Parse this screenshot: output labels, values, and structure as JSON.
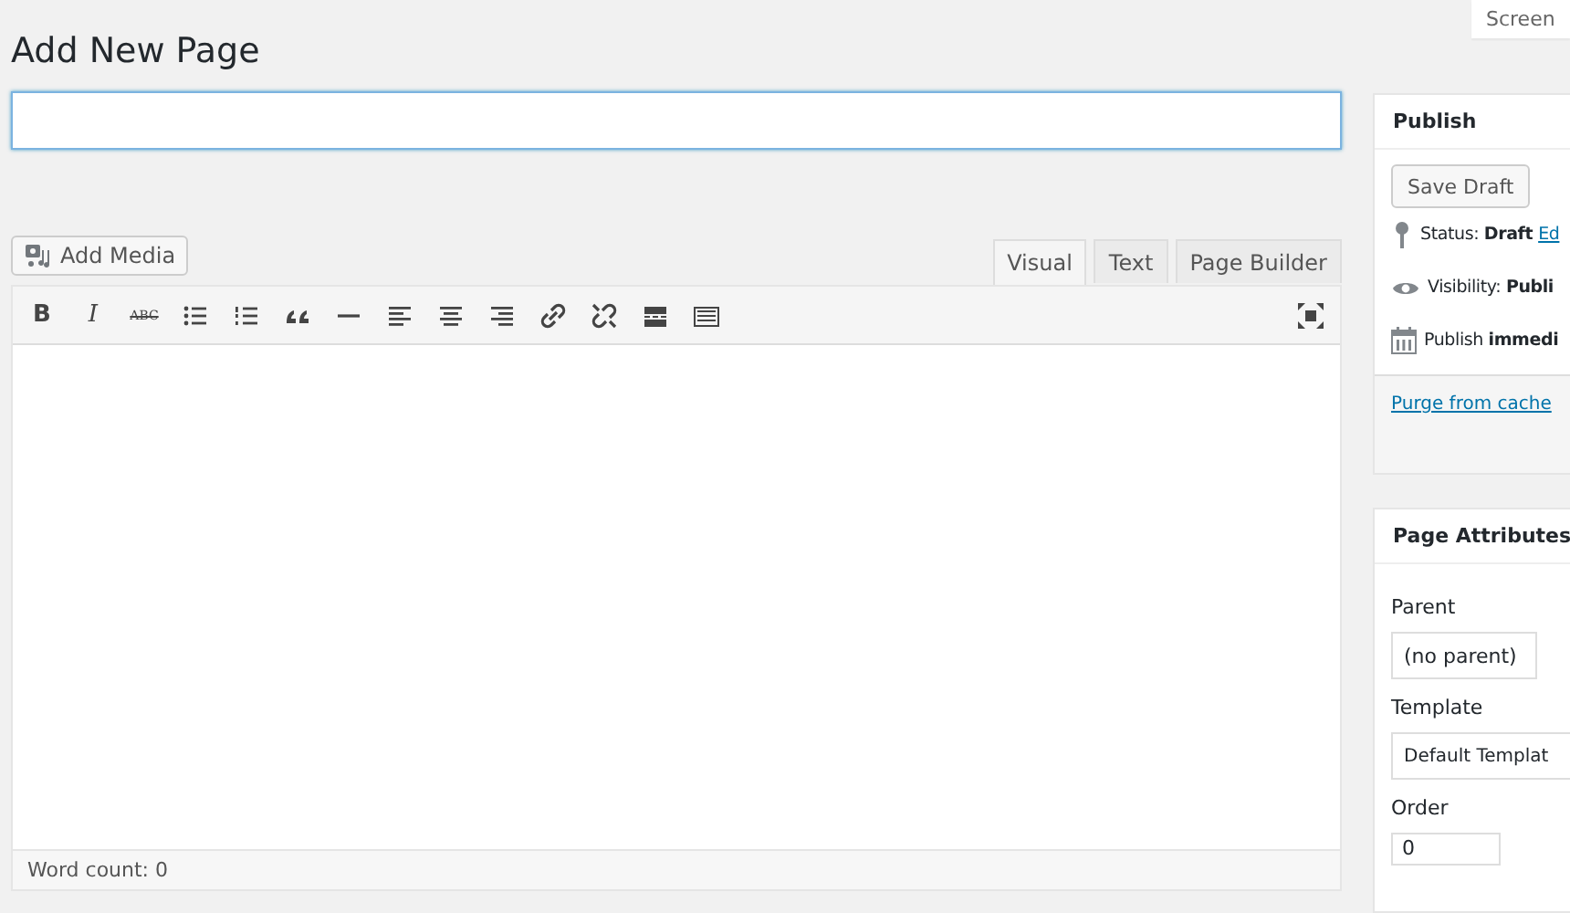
{
  "screen_options": "Screen",
  "heading": "Add New Page",
  "title_field": {
    "focused": true
  },
  "add_media": "Add Media",
  "editor_tabs": [
    {
      "label": "Visual",
      "selected": true
    },
    {
      "label": "Text",
      "selected": false
    },
    {
      "label": "Page Builder",
      "selected": false
    }
  ],
  "toolbar_glyphs": [
    {
      "kind": "bold",
      "text": "B"
    },
    {
      "kind": "italic",
      "text": "I"
    },
    {
      "kind": "strike",
      "text": "ABC"
    }
  ],
  "word_count": "Word count: 0",
  "publish": {
    "title": "Publish",
    "save_draft": "Save Draft",
    "rows": [
      {
        "kind": "status",
        "text": "Status: **Draft**",
        "link": "Ed"
      },
      {
        "kind": "visibility",
        "text": "Visibility: **Publi**"
      },
      {
        "kind": "schedule",
        "text": "Publish **immedi**"
      }
    ],
    "purge": "Purge from cache"
  },
  "attributes": {
    "title": "Page Attributes",
    "parent_label": "Parent",
    "parent_value": "(no parent)",
    "template_label": "Template",
    "template_value": "Default Templat",
    "order_label": "Order",
    "order_value": "0"
  }
}
